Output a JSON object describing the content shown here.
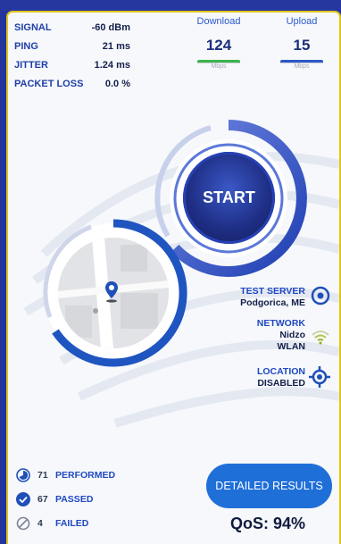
{
  "stats": [
    {
      "label": "SIGNAL",
      "value": "-60 dBm"
    },
    {
      "label": "PING",
      "value": "21 ms"
    },
    {
      "label": "JITTER",
      "value": "1.24 ms"
    },
    {
      "label": "PACKET LOSS",
      "value": "0.0 %"
    }
  ],
  "download": {
    "title": "Download",
    "value": "124",
    "unit": "Mbps",
    "color": "#3bb54a"
  },
  "upload": {
    "title": "Upload",
    "value": "15",
    "unit": "Mbps",
    "color": "#2c58c9"
  },
  "start_label": "START",
  "test_server": {
    "heading": "TEST SERVER",
    "value": "Podgorica, ME",
    "icon": "target-icon"
  },
  "network": {
    "heading": "NETWORK",
    "name": "Nidzo",
    "type": "WLAN",
    "icon": "wifi-icon"
  },
  "location": {
    "heading": "LOCATION",
    "value": "DISABLED",
    "icon": "crosshair-icon"
  },
  "counters": [
    {
      "count": "71",
      "label": "PERFORMED",
      "icon": "pie-progress-icon"
    },
    {
      "count": "67",
      "label": "PASSED",
      "icon": "check-circle-icon"
    },
    {
      "count": "4",
      "label": "FAILED",
      "icon": "no-entry-icon"
    }
  ],
  "details_label": "DETAILED RESULTS",
  "qos": "QoS: 94%",
  "colors": {
    "background": "#23349c",
    "accent": "#1f48c1",
    "border": "#e2c31b",
    "button": "#1f6fd9"
  }
}
